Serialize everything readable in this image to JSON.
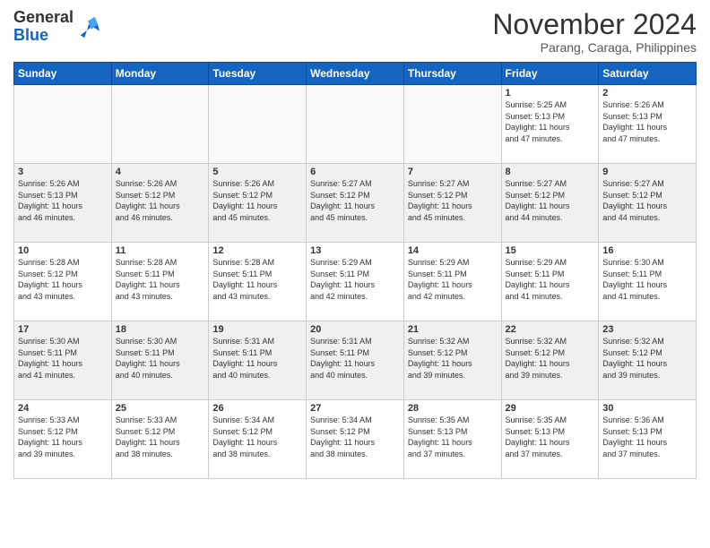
{
  "header": {
    "logo": {
      "line1": "General",
      "line2": "Blue"
    },
    "title": "November 2024",
    "location": "Parang, Caraga, Philippines"
  },
  "weekdays": [
    "Sunday",
    "Monday",
    "Tuesday",
    "Wednesday",
    "Thursday",
    "Friday",
    "Saturday"
  ],
  "weeks": [
    [
      {
        "day": "",
        "info": ""
      },
      {
        "day": "",
        "info": ""
      },
      {
        "day": "",
        "info": ""
      },
      {
        "day": "",
        "info": ""
      },
      {
        "day": "",
        "info": ""
      },
      {
        "day": "1",
        "info": "Sunrise: 5:25 AM\nSunset: 5:13 PM\nDaylight: 11 hours\nand 47 minutes."
      },
      {
        "day": "2",
        "info": "Sunrise: 5:26 AM\nSunset: 5:13 PM\nDaylight: 11 hours\nand 47 minutes."
      }
    ],
    [
      {
        "day": "3",
        "info": "Sunrise: 5:26 AM\nSunset: 5:13 PM\nDaylight: 11 hours\nand 46 minutes."
      },
      {
        "day": "4",
        "info": "Sunrise: 5:26 AM\nSunset: 5:12 PM\nDaylight: 11 hours\nand 46 minutes."
      },
      {
        "day": "5",
        "info": "Sunrise: 5:26 AM\nSunset: 5:12 PM\nDaylight: 11 hours\nand 45 minutes."
      },
      {
        "day": "6",
        "info": "Sunrise: 5:27 AM\nSunset: 5:12 PM\nDaylight: 11 hours\nand 45 minutes."
      },
      {
        "day": "7",
        "info": "Sunrise: 5:27 AM\nSunset: 5:12 PM\nDaylight: 11 hours\nand 45 minutes."
      },
      {
        "day": "8",
        "info": "Sunrise: 5:27 AM\nSunset: 5:12 PM\nDaylight: 11 hours\nand 44 minutes."
      },
      {
        "day": "9",
        "info": "Sunrise: 5:27 AM\nSunset: 5:12 PM\nDaylight: 11 hours\nand 44 minutes."
      }
    ],
    [
      {
        "day": "10",
        "info": "Sunrise: 5:28 AM\nSunset: 5:12 PM\nDaylight: 11 hours\nand 43 minutes."
      },
      {
        "day": "11",
        "info": "Sunrise: 5:28 AM\nSunset: 5:11 PM\nDaylight: 11 hours\nand 43 minutes."
      },
      {
        "day": "12",
        "info": "Sunrise: 5:28 AM\nSunset: 5:11 PM\nDaylight: 11 hours\nand 43 minutes."
      },
      {
        "day": "13",
        "info": "Sunrise: 5:29 AM\nSunset: 5:11 PM\nDaylight: 11 hours\nand 42 minutes."
      },
      {
        "day": "14",
        "info": "Sunrise: 5:29 AM\nSunset: 5:11 PM\nDaylight: 11 hours\nand 42 minutes."
      },
      {
        "day": "15",
        "info": "Sunrise: 5:29 AM\nSunset: 5:11 PM\nDaylight: 11 hours\nand 41 minutes."
      },
      {
        "day": "16",
        "info": "Sunrise: 5:30 AM\nSunset: 5:11 PM\nDaylight: 11 hours\nand 41 minutes."
      }
    ],
    [
      {
        "day": "17",
        "info": "Sunrise: 5:30 AM\nSunset: 5:11 PM\nDaylight: 11 hours\nand 41 minutes."
      },
      {
        "day": "18",
        "info": "Sunrise: 5:30 AM\nSunset: 5:11 PM\nDaylight: 11 hours\nand 40 minutes."
      },
      {
        "day": "19",
        "info": "Sunrise: 5:31 AM\nSunset: 5:11 PM\nDaylight: 11 hours\nand 40 minutes."
      },
      {
        "day": "20",
        "info": "Sunrise: 5:31 AM\nSunset: 5:11 PM\nDaylight: 11 hours\nand 40 minutes."
      },
      {
        "day": "21",
        "info": "Sunrise: 5:32 AM\nSunset: 5:12 PM\nDaylight: 11 hours\nand 39 minutes."
      },
      {
        "day": "22",
        "info": "Sunrise: 5:32 AM\nSunset: 5:12 PM\nDaylight: 11 hours\nand 39 minutes."
      },
      {
        "day": "23",
        "info": "Sunrise: 5:32 AM\nSunset: 5:12 PM\nDaylight: 11 hours\nand 39 minutes."
      }
    ],
    [
      {
        "day": "24",
        "info": "Sunrise: 5:33 AM\nSunset: 5:12 PM\nDaylight: 11 hours\nand 39 minutes."
      },
      {
        "day": "25",
        "info": "Sunrise: 5:33 AM\nSunset: 5:12 PM\nDaylight: 11 hours\nand 38 minutes."
      },
      {
        "day": "26",
        "info": "Sunrise: 5:34 AM\nSunset: 5:12 PM\nDaylight: 11 hours\nand 38 minutes."
      },
      {
        "day": "27",
        "info": "Sunrise: 5:34 AM\nSunset: 5:12 PM\nDaylight: 11 hours\nand 38 minutes."
      },
      {
        "day": "28",
        "info": "Sunrise: 5:35 AM\nSunset: 5:13 PM\nDaylight: 11 hours\nand 37 minutes."
      },
      {
        "day": "29",
        "info": "Sunrise: 5:35 AM\nSunset: 5:13 PM\nDaylight: 11 hours\nand 37 minutes."
      },
      {
        "day": "30",
        "info": "Sunrise: 5:36 AM\nSunset: 5:13 PM\nDaylight: 11 hours\nand 37 minutes."
      }
    ]
  ]
}
